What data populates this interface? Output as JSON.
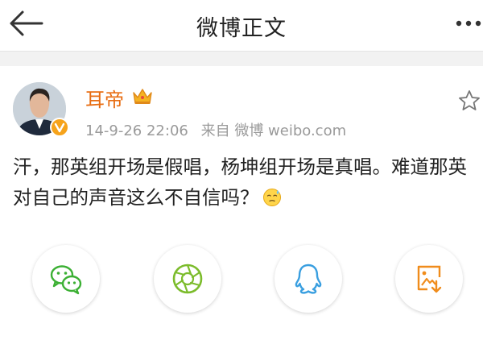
{
  "header": {
    "title": "微博正文",
    "back_icon": "arrow-left-icon",
    "more_icon": "more-dots-icon"
  },
  "post": {
    "username": "耳帝",
    "username_color": "#e86d12",
    "timestamp": "14-9-26 22:06",
    "source": "来自 微博 weibo.com",
    "text": "汗，那英组开场是假唱，杨坤组开场是真唱。难道那英对自己的声音这么不自信吗？",
    "emoji_icon": "sweat-face-icon",
    "badge_icon": "verified-v-icon",
    "crown_icon": "crown-icon",
    "favorite_icon": "star-outline-icon"
  },
  "share": {
    "buttons": [
      {
        "name": "wechat-share-button",
        "icon": "wechat-icon",
        "color": "#3cb034"
      },
      {
        "name": "moments-share-button",
        "icon": "camera-aperture-icon",
        "color": "#7cbc2c"
      },
      {
        "name": "qq-share-button",
        "icon": "qq-penguin-icon",
        "color": "#3a9fe0"
      },
      {
        "name": "save-image-button",
        "icon": "save-image-icon",
        "color": "#f08c1c"
      }
    ]
  }
}
